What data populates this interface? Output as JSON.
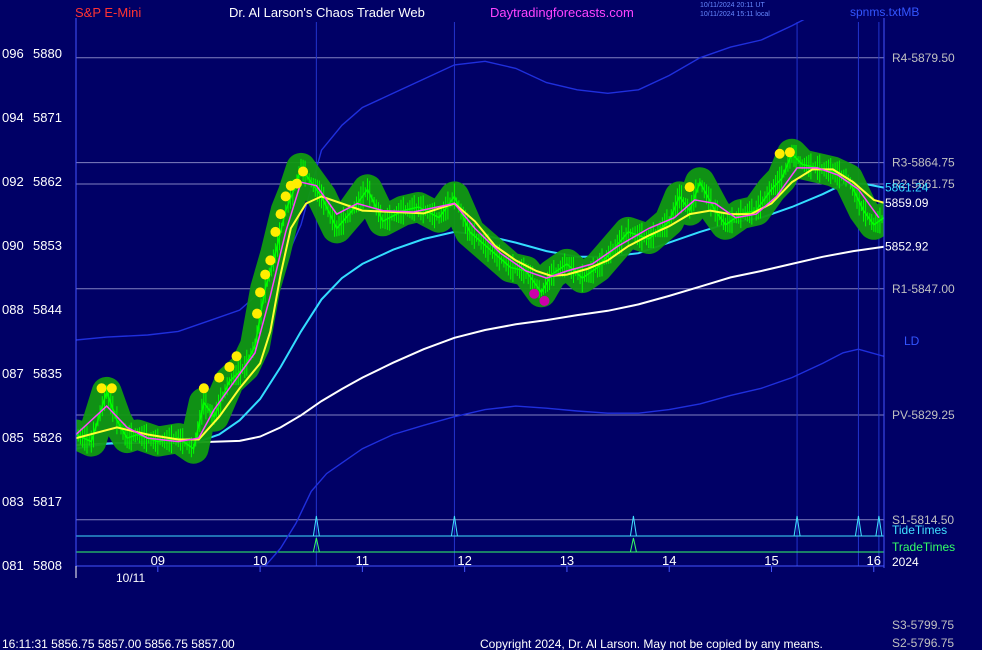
{
  "header": {
    "symbol": "S&P E-Mini",
    "author_site": "Dr. Al Larson's Chaos Trader Web",
    "url": "Daytradingforecasts.com",
    "stamp_line1": "10/11/2024 20:11 UT",
    "stamp_line2": "10/11/2024 15:11 local",
    "file": "spnms.txtMB"
  },
  "footer": {
    "quote": "16:11:31  5856.75 5857.00 5856.75 5857.00",
    "copyright": "Copyright 2024, Dr. Al Larson. May not be copied by any means."
  },
  "colors": {
    "background": "#000066",
    "price": "#00ff00",
    "glow": "#119911",
    "fast_ma": "#ff44ff",
    "mid_ma": "#ffff33",
    "ma_cyan": "#33ddff",
    "ma_white": "#ffffff",
    "band_blue": "#1f2fdd",
    "pivot_line": "#8080c0",
    "tide": "#40e0ff",
    "trade": "#33ff66",
    "top_dots": "#ffee00",
    "bottom_dots": "#cc00aa"
  },
  "chart_data": {
    "type": "line",
    "title": "S&P E-Mini",
    "x_label": "10/11",
    "x_ticks": [
      "09",
      "10",
      "11",
      "12",
      "13",
      "14",
      "15",
      "16"
    ],
    "x_range": [
      8.2,
      16.1
    ],
    "y_range": [
      5808,
      5882
    ],
    "y_ticks": [
      {
        "left": "096",
        "value": 5880
      },
      {
        "left": "094",
        "value": 5871
      },
      {
        "left": "092",
        "value": 5862
      },
      {
        "left": "090",
        "value": 5853
      },
      {
        "left": "088",
        "value": 5844
      },
      {
        "left": "087",
        "value": 5835
      },
      {
        "left": "085",
        "value": 5826
      },
      {
        "left": "083",
        "value": 5817
      },
      {
        "left": "081",
        "value": 5808
      }
    ],
    "levels": [
      {
        "label": "R4-5879.50",
        "value": 5879.5
      },
      {
        "label": "R3-5864.75",
        "value": 5864.75
      },
      {
        "label": "R2-5861.75",
        "value": 5861.75
      },
      {
        "label": "R1-5847.00",
        "value": 5847.0
      },
      {
        "label": "PV-5829.25",
        "value": 5829.25
      },
      {
        "label": "S1-5814.50",
        "value": 5814.5
      }
    ],
    "offchart_levels": [
      "S3-5799.75",
      "S2-5796.75"
    ],
    "end_labels": [
      {
        "text": "5861.24",
        "value": 5861.24,
        "series": "ma_cyan"
      },
      {
        "text": "5859.09",
        "value": 5859.09,
        "series": "mid_ma"
      },
      {
        "text": "5852.92",
        "value": 5852.92,
        "series": "ma_white"
      }
    ],
    "band_label": "LD",
    "tide_label": "TideTimes",
    "trade_label": "TradeTimes",
    "year_label": "2024",
    "tide_times": [
      10.55,
      11.9,
      13.65,
      15.25,
      15.85,
      16.05
    ],
    "trade_times": [
      10.55,
      13.65
    ],
    "vertical_lines": [
      10.55,
      11.9,
      15.25,
      15.85,
      16.05
    ],
    "series": [
      {
        "key": "price",
        "x": [
          8.2,
          8.35,
          8.5,
          8.6,
          8.7,
          8.8,
          9.0,
          9.2,
          9.35,
          9.45,
          9.55,
          9.7,
          9.85,
          9.95,
          10.05,
          10.15,
          10.25,
          10.32,
          10.4,
          10.5,
          10.6,
          10.75,
          10.9,
          11.05,
          11.2,
          11.4,
          11.55,
          11.75,
          11.9,
          12.05,
          12.25,
          12.45,
          12.6,
          12.75,
          12.85,
          13.0,
          13.15,
          13.3,
          13.45,
          13.6,
          13.8,
          14.0,
          14.1,
          14.2,
          14.3,
          14.45,
          14.55,
          14.7,
          14.85,
          15.0,
          15.1,
          15.2,
          15.3,
          15.45,
          15.6,
          15.75,
          15.9,
          16.0,
          16.1
        ],
        "values": [
          5826.5,
          5825.5,
          5832.5,
          5828.5,
          5826.0,
          5826.5,
          5825.5,
          5826.0,
          5824.5,
          5831.0,
          5829.0,
          5834.0,
          5836.0,
          5839.0,
          5847.0,
          5852.0,
          5858.0,
          5860.5,
          5864.0,
          5862.0,
          5860.0,
          5855.5,
          5858.0,
          5861.0,
          5856.5,
          5858.0,
          5858.5,
          5857.0,
          5860.0,
          5855.0,
          5852.5,
          5850.0,
          5849.5,
          5846.5,
          5849.0,
          5850.5,
          5848.5,
          5850.0,
          5852.5,
          5855.0,
          5854.0,
          5856.5,
          5860.0,
          5858.0,
          5862.0,
          5858.0,
          5856.0,
          5857.5,
          5858.0,
          5861.0,
          5862.5,
          5866.0,
          5864.5,
          5864.0,
          5863.5,
          5862.5,
          5858.0,
          5856.0,
          5857.0
        ]
      },
      {
        "key": "fast_ma",
        "x": [
          8.2,
          8.5,
          8.7,
          8.9,
          9.2,
          9.4,
          9.55,
          9.75,
          9.95,
          10.1,
          10.25,
          10.4,
          10.55,
          10.75,
          10.95,
          11.2,
          11.5,
          11.9,
          12.1,
          12.35,
          12.6,
          12.8,
          13.0,
          13.25,
          13.5,
          13.8,
          14.05,
          14.25,
          14.45,
          14.65,
          14.85,
          15.05,
          15.25,
          15.45,
          15.65,
          15.85,
          16.05
        ],
        "values": [
          5826.5,
          5830.5,
          5827.5,
          5826.0,
          5825.5,
          5826.0,
          5830.0,
          5834.0,
          5838.0,
          5846.0,
          5855.0,
          5862.0,
          5861.5,
          5857.5,
          5859.0,
          5858.0,
          5857.8,
          5859.0,
          5855.5,
          5852.0,
          5849.5,
          5848.5,
          5849.5,
          5850.5,
          5853.0,
          5855.5,
          5857.0,
          5859.5,
          5859.0,
          5857.0,
          5857.5,
          5860.0,
          5864.0,
          5864.0,
          5863.0,
          5861.0,
          5857.0
        ]
      },
      {
        "key": "mid_ma",
        "x": [
          8.2,
          8.6,
          8.9,
          9.2,
          9.4,
          9.6,
          9.8,
          10.0,
          10.1,
          10.2,
          10.3,
          10.45,
          10.6,
          10.8,
          11.0,
          11.3,
          11.6,
          11.9,
          12.1,
          12.3,
          12.5,
          12.7,
          12.85,
          13.0,
          13.2,
          13.4,
          13.6,
          13.8,
          14.0,
          14.2,
          14.4,
          14.6,
          14.8,
          15.0,
          15.2,
          15.4,
          15.6,
          15.8,
          16.0,
          16.1
        ],
        "values": [
          5826.0,
          5827.5,
          5826.5,
          5825.8,
          5825.8,
          5829.0,
          5833.0,
          5836.5,
          5841.0,
          5849.0,
          5855.5,
          5859.0,
          5860.0,
          5859.0,
          5858.0,
          5857.8,
          5857.6,
          5859.0,
          5856.5,
          5853.0,
          5851.0,
          5849.5,
          5848.8,
          5849.0,
          5849.8,
          5851.0,
          5853.0,
          5854.5,
          5855.8,
          5857.5,
          5858.0,
          5857.5,
          5857.5,
          5859.0,
          5862.0,
          5863.8,
          5863.8,
          5862.0,
          5859.5,
          5859.1
        ]
      },
      {
        "key": "ma_cyan",
        "x": [
          8.2,
          8.5,
          8.9,
          9.2,
          9.4,
          9.6,
          9.8,
          10.0,
          10.2,
          10.4,
          10.6,
          10.8,
          11.0,
          11.3,
          11.6,
          11.9,
          12.2,
          12.5,
          12.8,
          13.1,
          13.4,
          13.7,
          14.0,
          14.3,
          14.6,
          14.9,
          15.2,
          15.5,
          15.7,
          15.9,
          16.1
        ],
        "values": [
          5824.5,
          5825.2,
          5825.5,
          5825.5,
          5825.5,
          5826.5,
          5828.5,
          5831.5,
          5836.0,
          5841.0,
          5845.5,
          5848.5,
          5850.5,
          5852.5,
          5854.0,
          5855.0,
          5854.5,
          5853.5,
          5852.3,
          5851.5,
          5851.5,
          5852.0,
          5853.5,
          5855.0,
          5856.3,
          5857.0,
          5858.5,
          5860.3,
          5861.7,
          5861.8,
          5861.24
        ]
      },
      {
        "key": "ma_white",
        "x": [
          8.2,
          8.6,
          9.0,
          9.4,
          9.8,
          10.0,
          10.2,
          10.4,
          10.6,
          10.8,
          11.0,
          11.3,
          11.6,
          11.9,
          12.2,
          12.5,
          12.8,
          13.1,
          13.4,
          13.7,
          14.0,
          14.3,
          14.6,
          14.9,
          15.2,
          15.5,
          15.8,
          16.1
        ],
        "values": [
          5825.0,
          5825.3,
          5825.3,
          5825.4,
          5825.6,
          5826.2,
          5827.5,
          5829.2,
          5831.2,
          5832.9,
          5834.5,
          5836.6,
          5838.5,
          5840.1,
          5841.2,
          5842.0,
          5842.6,
          5843.3,
          5843.9,
          5844.8,
          5846.0,
          5847.3,
          5848.6,
          5849.5,
          5850.5,
          5851.5,
          5852.3,
          5852.92
        ]
      },
      {
        "key": "band_upper",
        "x": [
          8.2,
          8.5,
          8.9,
          9.2,
          9.5,
          9.8,
          10.0,
          10.2,
          10.4,
          10.6,
          10.8,
          11.0,
          11.3,
          11.6,
          11.9,
          12.2,
          12.5,
          12.8,
          13.1,
          13.4,
          13.7,
          14.0,
          14.3,
          14.6,
          14.9,
          15.2,
          15.4
        ],
        "values": [
          5839.8,
          5840.2,
          5840.5,
          5841.0,
          5842.5,
          5844.0,
          5846.5,
          5849.5,
          5856.0,
          5866.5,
          5870.0,
          5872.5,
          5874.5,
          5876.5,
          5878.5,
          5879.0,
          5878.0,
          5876.0,
          5875.0,
          5874.5,
          5875.0,
          5877.0,
          5879.5,
          5881.0,
          5882.0,
          5884.0,
          5885.5
        ]
      },
      {
        "key": "band_lower",
        "x": [
          10.05,
          10.2,
          10.35,
          10.5,
          10.65,
          10.8,
          11.0,
          11.3,
          11.6,
          11.9,
          12.2,
          12.5,
          12.8,
          13.1,
          13.4,
          13.7,
          14.0,
          14.3,
          14.6,
          14.9,
          15.2,
          15.5,
          15.7,
          15.85,
          16.1
        ],
        "values": [
          5808.0,
          5810.5,
          5814.0,
          5818.5,
          5821.0,
          5822.5,
          5824.5,
          5826.5,
          5827.8,
          5829.0,
          5830.0,
          5830.5,
          5830.2,
          5829.8,
          5829.5,
          5829.5,
          5830.0,
          5830.8,
          5832.0,
          5833.0,
          5834.5,
          5836.5,
          5838.0,
          5838.5,
          5837.5
        ]
      }
    ],
    "top_markers": {
      "x": [
        8.45,
        8.55,
        9.45,
        9.6,
        9.7,
        9.77,
        9.97,
        10.0,
        10.05,
        10.1,
        10.15,
        10.2,
        10.25,
        10.3,
        10.36,
        10.42,
        14.2,
        15.08,
        15.18
      ],
      "values": [
        5833.0,
        5833.0,
        5833.0,
        5834.5,
        5836.0,
        5837.5,
        5843.5,
        5846.5,
        5849.0,
        5851.0,
        5855.0,
        5857.5,
        5860.0,
        5861.5,
        5861.8,
        5863.5,
        5861.3,
        5866.0,
        5866.2
      ]
    },
    "bottom_markers": {
      "x": [
        12.68,
        12.78
      ],
      "values": [
        5846.3,
        5845.3
      ]
    }
  }
}
